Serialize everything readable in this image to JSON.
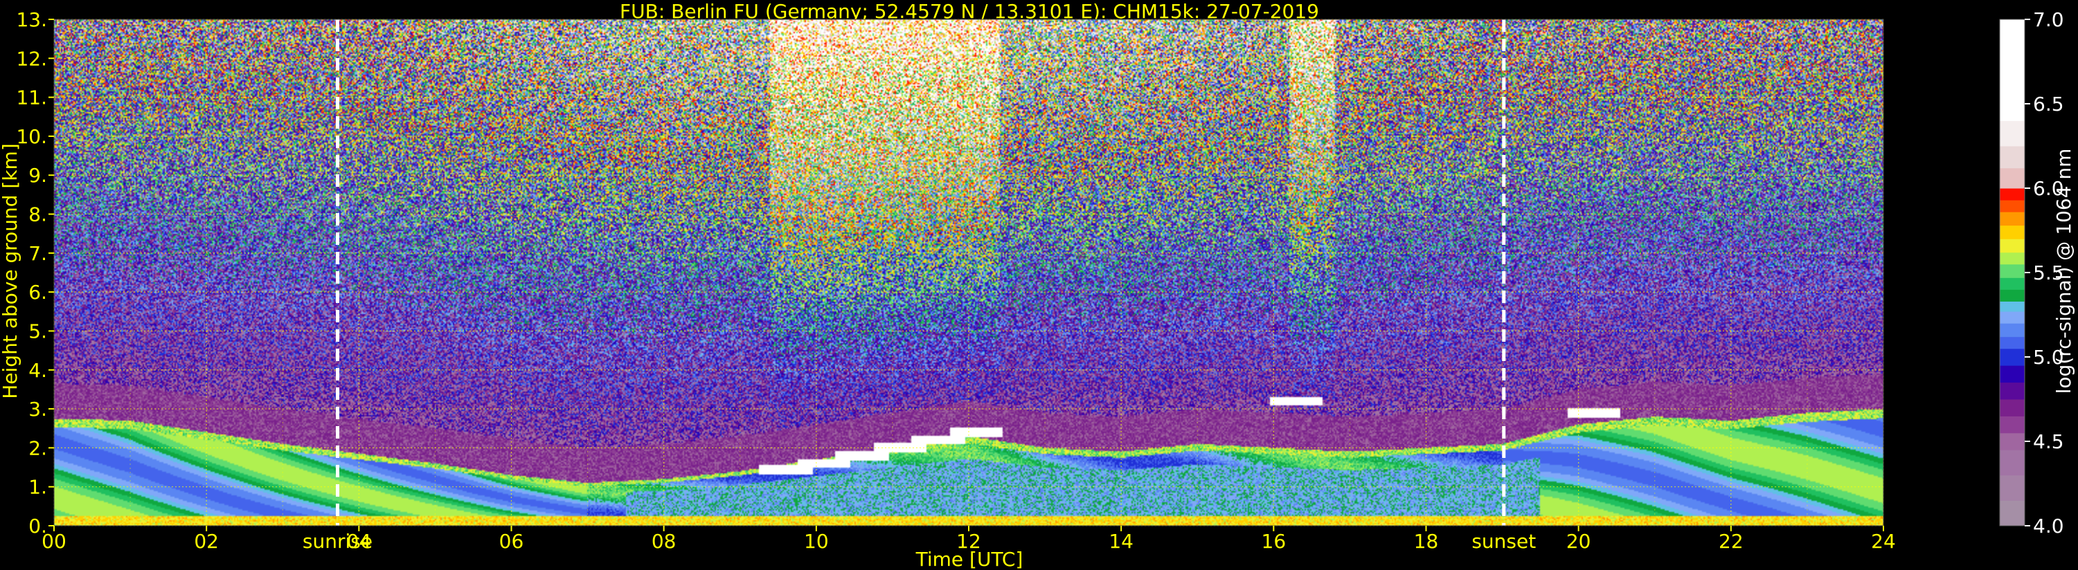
{
  "title": "FUB: Berlin FU (Germany; 52.4579 N / 13.3101 E):    CHM15k: 27-07-2019",
  "colors": {
    "background": "#000000",
    "axis_text": "#ffff00",
    "grid": "#ffff00",
    "colorbar_text": "#ffffff",
    "marker_line": "#ffffff"
  },
  "chart_data": {
    "type": "heatmap",
    "title": "FUB: Berlin FU (Germany; 52.4579 N / 13.3101 E):    CHM15k: 27-07-2019",
    "xlabel": "Time [UTC]",
    "ylabel": "Height above ground [km]",
    "xlim": [
      0,
      24
    ],
    "ylim": [
      0,
      13
    ],
    "x_ticks": [
      "00",
      "02",
      "04",
      "06",
      "08",
      "10",
      "12",
      "14",
      "16",
      "18",
      "20",
      "22",
      "24"
    ],
    "y_ticks": [
      "0.",
      "1.",
      "2.",
      "3.",
      "4.",
      "5.",
      "6.",
      "7.",
      "8.",
      "9.",
      "10.",
      "11.",
      "12.",
      "13."
    ],
    "grid": true,
    "annotations": [
      {
        "label": "sunrise",
        "x": 3.72
      },
      {
        "label": "sunset",
        "x": 19.02
      }
    ],
    "colorbar": {
      "label": "log(rc-signal) @ 1064 nm",
      "range": [
        4.0,
        7.0
      ],
      "ticks": [
        "4.0",
        "4.5",
        "5.0",
        "5.5",
        "6.0",
        "6.5",
        "7.0"
      ],
      "levels": [
        {
          "v": 4.0,
          "color": "#a58fa6"
        },
        {
          "v": 4.15,
          "color": "#a582a6"
        },
        {
          "v": 4.3,
          "color": "#a274a5"
        },
        {
          "v": 4.45,
          "color": "#a066a0"
        },
        {
          "v": 4.55,
          "color": "#8e3f95"
        },
        {
          "v": 4.65,
          "color": "#7a208c"
        },
        {
          "v": 4.75,
          "color": "#5a0a9a"
        },
        {
          "v": 4.85,
          "color": "#2a00b4"
        },
        {
          "v": 4.95,
          "color": "#2030d8"
        },
        {
          "v": 5.05,
          "color": "#4464ec"
        },
        {
          "v": 5.12,
          "color": "#5a86f2"
        },
        {
          "v": 5.2,
          "color": "#80a8f8"
        },
        {
          "v": 5.27,
          "color": "#60c0e6"
        },
        {
          "v": 5.33,
          "color": "#10a840"
        },
        {
          "v": 5.4,
          "color": "#20c060"
        },
        {
          "v": 5.47,
          "color": "#60dc70"
        },
        {
          "v": 5.55,
          "color": "#b0f050"
        },
        {
          "v": 5.62,
          "color": "#f0f030"
        },
        {
          "v": 5.7,
          "color": "#ffd000"
        },
        {
          "v": 5.78,
          "color": "#ff9800"
        },
        {
          "v": 5.86,
          "color": "#ff5000"
        },
        {
          "v": 5.93,
          "color": "#ff1000"
        },
        {
          "v": 6.0,
          "color": "#e8c0c0"
        },
        {
          "v": 6.12,
          "color": "#ead8d8"
        },
        {
          "v": 6.25,
          "color": "#f5eeee"
        },
        {
          "v": 6.4,
          "color": "#ffffff"
        },
        {
          "v": 7.0,
          "color": "#ffffff"
        }
      ]
    },
    "layers": {
      "boundary_layer_top_km": [
        [
          0,
          2.75
        ],
        [
          1,
          2.7
        ],
        [
          2,
          2.4
        ],
        [
          3,
          2.1
        ],
        [
          4,
          1.85
        ],
        [
          5,
          1.6
        ],
        [
          6,
          1.3
        ],
        [
          7,
          1.1
        ],
        [
          8,
          1.2
        ],
        [
          9,
          1.4
        ],
        [
          10,
          1.7
        ],
        [
          11,
          2.0
        ],
        [
          12,
          2.3
        ],
        [
          13,
          2.0
        ],
        [
          14,
          1.9
        ],
        [
          15,
          2.1
        ],
        [
          16,
          2.0
        ],
        [
          17,
          1.9
        ],
        [
          18,
          2.0
        ],
        [
          19,
          2.1
        ],
        [
          20,
          2.6
        ],
        [
          21,
          2.8
        ],
        [
          22,
          2.7
        ],
        [
          23,
          2.9
        ],
        [
          24,
          3.0
        ]
      ],
      "cloud_tops_km": [
        {
          "x": 9.6,
          "y": 1.45
        },
        {
          "x": 10.1,
          "y": 1.6
        },
        {
          "x": 10.6,
          "y": 1.8
        },
        {
          "x": 11.1,
          "y": 2.0
        },
        {
          "x": 11.6,
          "y": 2.2
        },
        {
          "x": 12.1,
          "y": 2.4
        },
        {
          "x": 16.3,
          "y": 3.2
        },
        {
          "x": 20.2,
          "y": 2.9
        }
      ]
    }
  }
}
